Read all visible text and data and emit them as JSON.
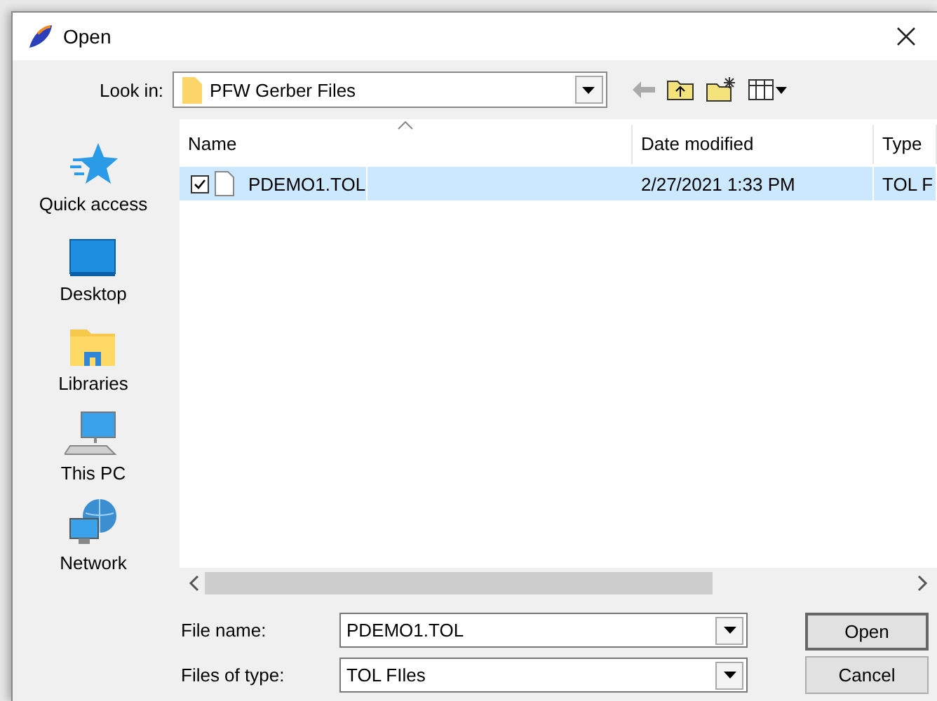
{
  "window": {
    "title": "Open"
  },
  "look_in": {
    "label": "Look in:",
    "value": "PFW Gerber Files"
  },
  "places": [
    {
      "label": "Quick access",
      "kind": "star"
    },
    {
      "label": "Desktop",
      "kind": "desktop"
    },
    {
      "label": "Libraries",
      "kind": "libraries"
    },
    {
      "label": "This PC",
      "kind": "pc"
    },
    {
      "label": "Network",
      "kind": "network"
    }
  ],
  "file_list": {
    "columns": [
      {
        "label": "Name",
        "sorted": true
      },
      {
        "label": "Date modified",
        "sorted": false
      },
      {
        "label": "Type",
        "sorted": false
      }
    ],
    "rows": [
      {
        "name": "PDEMO1.TOL",
        "date": "2/27/2021 1:33 PM",
        "type": "TOL F",
        "selected": true,
        "checked": true
      }
    ]
  },
  "file_name": {
    "label": "File name:",
    "value": "PDEMO1.TOL"
  },
  "file_type": {
    "label": "Files of type:",
    "value": "TOL FIles"
  },
  "buttons": [
    {
      "label": "Open",
      "default": true
    },
    {
      "label": "Cancel",
      "default": false
    }
  ]
}
